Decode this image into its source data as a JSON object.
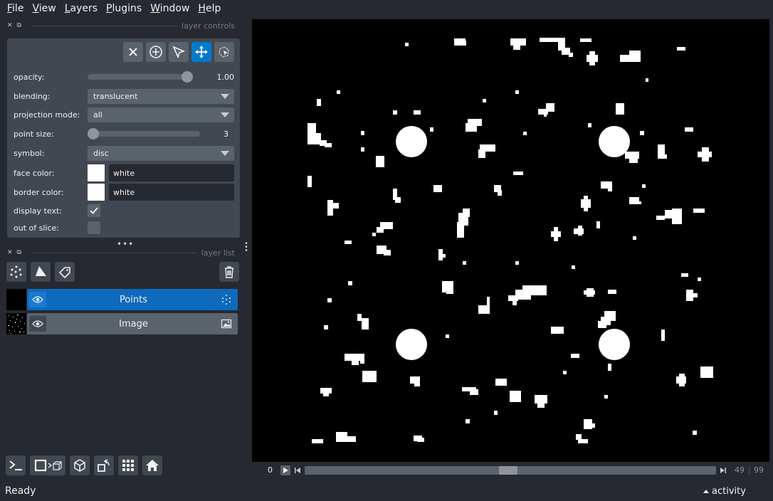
{
  "menubar": {
    "items": [
      {
        "first": "F",
        "rest": "ile"
      },
      {
        "first": "V",
        "rest": "iew"
      },
      {
        "first": "L",
        "rest": "ayers"
      },
      {
        "first": "P",
        "rest": "lugins"
      },
      {
        "first": "W",
        "rest": "indow"
      },
      {
        "first": "H",
        "rest": "elp"
      }
    ]
  },
  "layer_controls": {
    "title": "layer controls",
    "mode_buttons": [
      "delete-icon",
      "add-points-icon",
      "select-icon",
      "pan-zoom-icon",
      "transform-icon"
    ],
    "opacity": {
      "label": "opacity:",
      "value": "1.00",
      "fraction": 1.0
    },
    "blending": {
      "label": "blending:",
      "value": "translucent"
    },
    "projection_mode": {
      "label": "projection mode:",
      "value": "all"
    },
    "point_size": {
      "label": "point size:",
      "value": "3",
      "fraction": 0.0
    },
    "symbol": {
      "label": "symbol:",
      "value": "disc"
    },
    "face_color": {
      "label": "face color:",
      "value": "white",
      "swatch": "#ffffff"
    },
    "border_color": {
      "label": "border color:",
      "value": "white",
      "swatch": "#ffffff"
    },
    "display_text": {
      "label": "display text:",
      "checked": true
    },
    "out_of_slice": {
      "label": "out of slice:",
      "checked": false
    }
  },
  "layer_list": {
    "title": "layer list",
    "layers": [
      {
        "name": "Points",
        "selected": true,
        "type_icon": "points-icon"
      },
      {
        "name": "Image",
        "selected": false,
        "type_icon": "image-icon"
      }
    ]
  },
  "dims": {
    "start": "0",
    "current": "49",
    "total": "99",
    "position_fraction": 0.495
  },
  "status": {
    "text": "Ready",
    "activity": "activity"
  },
  "colors": {
    "background": "#262930",
    "panel": "#414851",
    "control": "#5a626c",
    "accent": "#007acc",
    "selected_layer": "#0d6abd"
  }
}
